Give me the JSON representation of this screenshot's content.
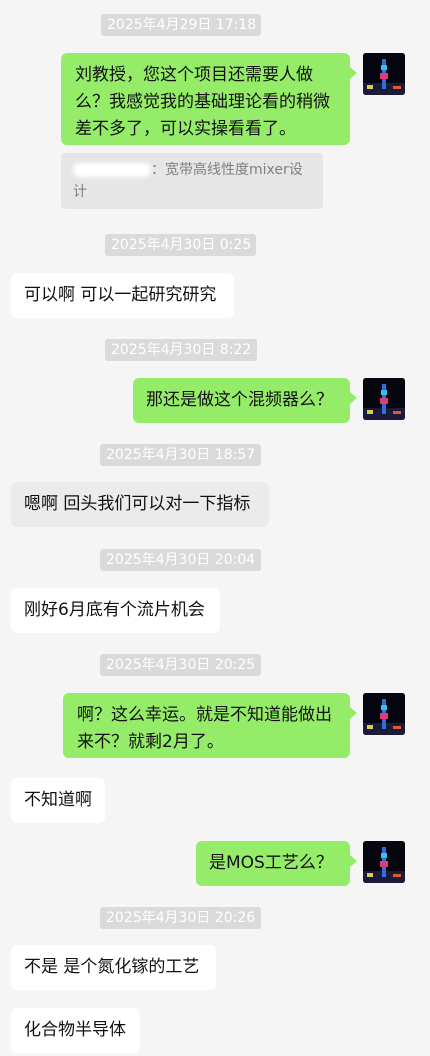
{
  "messages": [
    {
      "type": "time",
      "text": "2025年4月29日 17:18"
    },
    {
      "type": "msg",
      "side": "right",
      "text": "刘教授，您这个项目还需要人做么？我感觉我的基础理论看的稍微差不多了，可以实操看看了。"
    },
    {
      "type": "quote",
      "text": "：宽带高线性度mixer设计"
    },
    {
      "type": "time",
      "text": "2025年4月30日 0:25"
    },
    {
      "type": "msg",
      "side": "left",
      "text": "可以啊 可以一起研究研究"
    },
    {
      "type": "time",
      "text": "2025年4月30日 8:22"
    },
    {
      "type": "msg",
      "side": "right",
      "text": "那还是做这个混频器么？"
    },
    {
      "type": "time",
      "text": "2025年4月30日 18:57"
    },
    {
      "type": "msg",
      "side": "left",
      "text": "嗯啊 回头我们可以对一下指标"
    },
    {
      "type": "time",
      "text": "2025年4月30日 20:04"
    },
    {
      "type": "msg",
      "side": "left",
      "text": "刚好6月底有个流片机会"
    },
    {
      "type": "time",
      "text": "2025年4月30日 20:25"
    },
    {
      "type": "msg",
      "side": "right",
      "text": "啊？这么幸运。就是不知道能做出来不？就剩2月了。"
    },
    {
      "type": "msg",
      "side": "left",
      "text": "不知道啊"
    },
    {
      "type": "msg",
      "side": "right",
      "text": "是MOS工艺么？"
    },
    {
      "type": "time",
      "text": "2025年4月30日 20:26"
    },
    {
      "type": "msg",
      "side": "left",
      "text": "不是 是个氮化镓的工艺"
    },
    {
      "type": "msg",
      "side": "left",
      "text": "化合物半导体"
    }
  ],
  "colors": {
    "right_bubble": "#95ec69",
    "left_bubble": "#ffffff",
    "background": "#f5f5f5"
  },
  "icons": {
    "avatar": "tower-night-photo-avatar"
  }
}
